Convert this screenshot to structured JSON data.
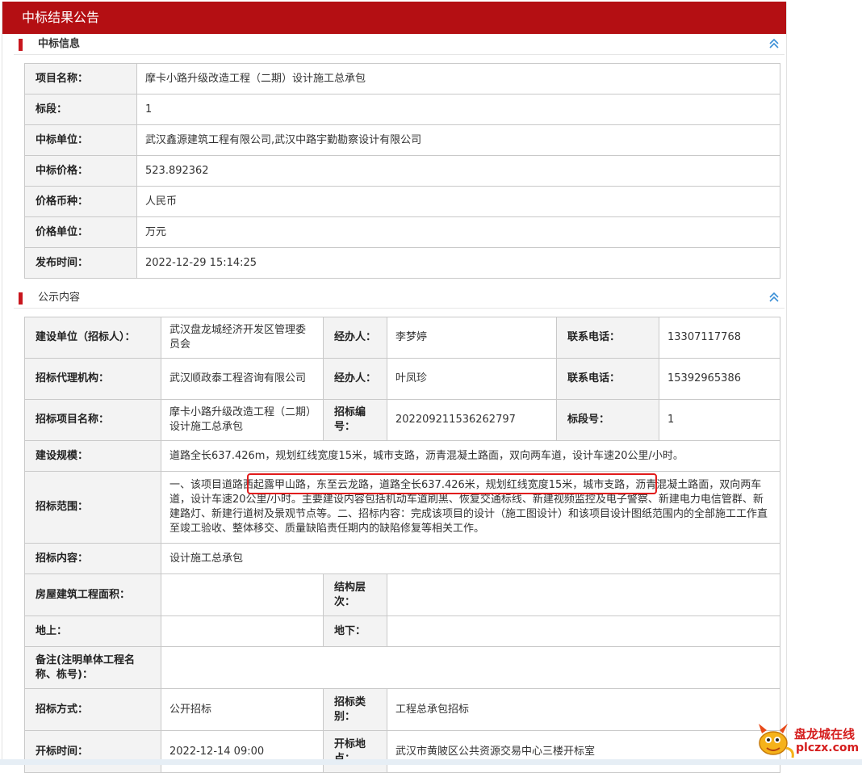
{
  "page": {
    "title": "中标结果公告"
  },
  "section1": {
    "title": "中标信息",
    "rows": [
      {
        "label": "项目名称：",
        "value": "摩卡小路升级改造工程（二期）设计施工总承包"
      },
      {
        "label": "标段：",
        "value": "1"
      },
      {
        "label": "中标单位：",
        "value": "武汉鑫源建筑工程有限公司,武汉中路宇勤勘察设计有限公司"
      },
      {
        "label": "中标价格：",
        "value": "523.892362"
      },
      {
        "label": "价格币种：",
        "value": "人民币"
      },
      {
        "label": "价格单位：",
        "value": "万元"
      },
      {
        "label": "发布时间：",
        "value": "2022-12-29 15:14:25"
      }
    ]
  },
  "section2": {
    "title": "公示内容",
    "owner_label": "建设单位（招标人）：",
    "owner_value": "武汉盘龙城经济开发区管理委员会",
    "handler_label": "经办人：",
    "handler1_value": "李梦婷",
    "phone_label": "联系电话：",
    "phone1_value": "13307117768",
    "agency_label": "招标代理机构：",
    "agency_value": "武汉顺政泰工程咨询有限公司",
    "handler2_value": "叶凤珍",
    "phone2_value": "15392965386",
    "project_label": "招标项目名称：",
    "project_value": "摩卡小路升级改造工程（二期）设计施工总承包",
    "code_label": "招标编号：",
    "code_value": "202209211536262797",
    "lot_label": "标段号：",
    "lot_value": "1",
    "scale_label": "建设规模：",
    "scale_value": "道路全长637.426m，规划红线宽度15米，城市支路，沥青混凝土路面，双向两车道，设计车速20公里/小时。",
    "scope_label": "招标范围：",
    "scope_value": "一、该项目道路西起露甲山路，东至云龙路，道路全长637.426米，规划红线宽度15米，城市支路，沥青混凝土路面，双向两车道，设计车速20公里/小时。主要建设内容包括机动车道刷黑、恢复交通标线、新建视频监控及电子警察、新建电力电信管群、新建路灯、新建行道树及景观节点等。二、招标内容：完成该项目的设计（施工图设计）和该项目设计图纸范围内的全部施工工作直至竣工验收、整体移交、质量缺陷责任期内的缺陷修复等相关工作。",
    "content_label": "招标内容：",
    "content_value": "设计施工总承包",
    "area_label": "房屋建筑工程面积：",
    "area_value": "",
    "floors_label": "结构层次：",
    "floors_value": "",
    "above_label": "地上：",
    "above_value": "",
    "below_label": "地下：",
    "below_value": "",
    "remark_label": "备注(注明单体工程名称、栋号)：",
    "remark_value": "",
    "method_label": "招标方式：",
    "method_value": "公开招标",
    "type_label": "招标类别：",
    "type_value": "工程总承包招标",
    "open_time_label": "开标时间：",
    "open_time_value": "2022-12-14 09:00",
    "open_place_label": "开标地点：",
    "open_place_value": "武汉市黄陂区公共资源交易中心三楼开标室"
  },
  "watermark": {
    "line1": "盘龙城在线",
    "line2": "plczx.com"
  },
  "colors": {
    "header_red": "#b40f13",
    "label_bg": "#f3f3f3",
    "border": "#c9c9c9",
    "highlight": "#e11b1b"
  }
}
